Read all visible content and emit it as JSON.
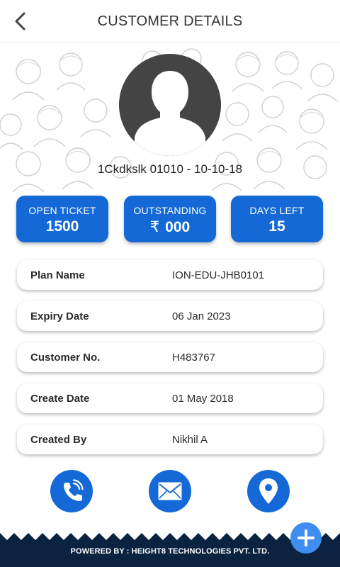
{
  "header": {
    "title": "CUSTOMER DETAILS",
    "back_icon": "chevron-left-icon"
  },
  "profile": {
    "id_line": "1Ckdkslk 01010 - 10-10-18",
    "avatar_icon": "person-silhouette-icon"
  },
  "stats": [
    {
      "label": "OPEN TICKET",
      "value": "1500"
    },
    {
      "label": "OUTSTANDING",
      "currency": "₹",
      "value": "000"
    },
    {
      "label": "DAYS LEFT",
      "value": "15"
    }
  ],
  "details": [
    {
      "label": "Plan Name",
      "value": "ION-EDU-JHB0101"
    },
    {
      "label": "Expiry Date",
      "value": "06 Jan 2023"
    },
    {
      "label": "Customer No.",
      "value": "H483767"
    },
    {
      "label": "Create Date",
      "value": "01 May 2018"
    },
    {
      "label": "Created By",
      "value": "Nikhil A"
    }
  ],
  "actions": [
    "phone-icon",
    "mail-icon",
    "location-pin-icon"
  ],
  "footer": {
    "text": "POWERED BY : HEIGHT8 TECHNOLOGIES PVT. LTD."
  },
  "fab_icon": "plus-icon",
  "colors": {
    "primary": "#1469d6",
    "footer": "#0b2340",
    "fab": "#3d8ef0"
  }
}
